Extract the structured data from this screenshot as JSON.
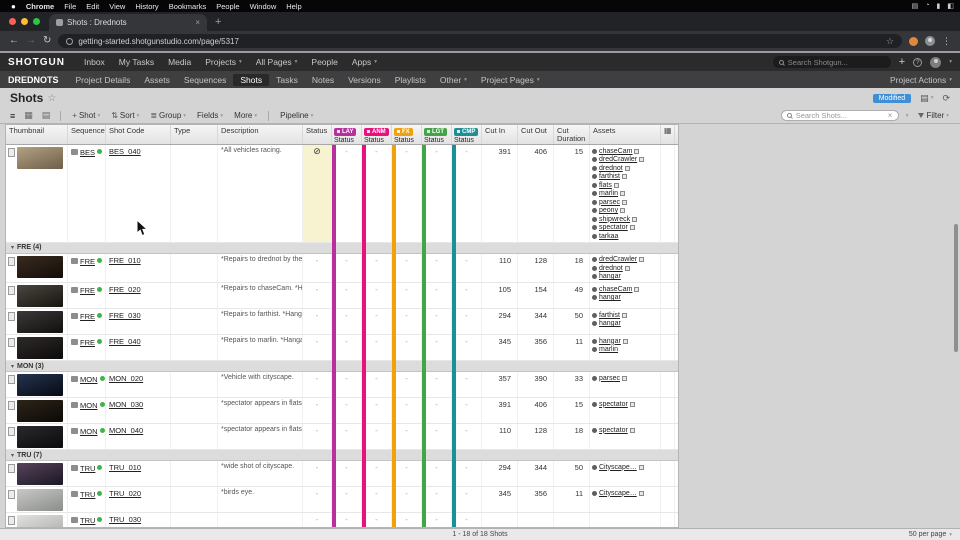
{
  "menubar": {
    "apple_icon": "apple-menu-icon",
    "items": [
      "Chrome",
      "File",
      "Edit",
      "View",
      "History",
      "Bookmarks",
      "People",
      "Window",
      "Help"
    ],
    "status_icons": [
      {
        "name": "display-icon",
        "glyph": "▤"
      },
      {
        "name": "wifi-icon",
        "glyph": "◔"
      },
      {
        "name": "battery-icon",
        "glyph": "▮"
      },
      {
        "name": "control-center-icon",
        "glyph": "◧"
      }
    ]
  },
  "browser": {
    "tab_title": "Shots : Drednots",
    "tab_close": "×",
    "url": "getting-started.shotgunstudio.com/page/5317"
  },
  "app_nav": {
    "logo": "SHOTGUN",
    "items": [
      {
        "label": "Inbox",
        "caret": false
      },
      {
        "label": "My Tasks",
        "caret": false
      },
      {
        "label": "Media",
        "caret": false
      },
      {
        "label": "Projects",
        "caret": true
      },
      {
        "label": "All Pages",
        "caret": true
      },
      {
        "label": "People",
        "caret": false
      },
      {
        "label": "Apps",
        "caret": true
      }
    ],
    "search_placeholder": "Search Shotgun..."
  },
  "project_nav": {
    "project": "DREDNOTS",
    "tabs": [
      {
        "label": "Project Details",
        "caret": false,
        "active": false
      },
      {
        "label": "Assets",
        "caret": false,
        "active": false
      },
      {
        "label": "Sequences",
        "caret": false,
        "active": false
      },
      {
        "label": "Shots",
        "caret": false,
        "active": true
      },
      {
        "label": "Tasks",
        "caret": false,
        "active": false
      },
      {
        "label": "Notes",
        "caret": false,
        "active": false
      },
      {
        "label": "Versions",
        "caret": false,
        "active": false
      },
      {
        "label": "Playlists",
        "caret": false,
        "active": false
      },
      {
        "label": "Other",
        "caret": true,
        "active": false
      },
      {
        "label": "Project Pages",
        "caret": true,
        "active": false
      }
    ],
    "actions": "Project Actions"
  },
  "page": {
    "title": "Shots",
    "star": "☆",
    "modified_badge": "Modified"
  },
  "toolbar": {
    "shot_button": "Shot",
    "sort": "Sort",
    "group": "Group",
    "fields": "Fields",
    "more": "More",
    "pipeline": "Pipeline",
    "search_placeholder": "Search Shots...",
    "filter": "Filter"
  },
  "table": {
    "headers": {
      "thumbnail": "Thumbnail",
      "sequence": "Sequence",
      "shot_code": "Shot Code",
      "type": "Type",
      "description": "Description",
      "status": "Status",
      "cut_in": "Cut In",
      "cut_out": "Cut Out",
      "cut_duration": "Cut Duration",
      "assets": "Assets"
    },
    "pipeline_columns": [
      {
        "label": "LAY",
        "sub": "Status",
        "color": "#b82f9e"
      },
      {
        "label": "ANM",
        "sub": "Status",
        "color": "#e8127d"
      },
      {
        "label": "FX",
        "sub": "Status",
        "color": "#f2a10e"
      },
      {
        "label": "LGT",
        "sub": "Status",
        "color": "#43a547"
      },
      {
        "label": "CMP",
        "sub": "Status",
        "color": "#1d8f96"
      }
    ],
    "groups": [
      {
        "header": null,
        "rows": [
          {
            "seq": "BES",
            "code": "BES_040",
            "desc": "*All vehicles racing.",
            "status": "omit",
            "status_bg": true,
            "pipe": [
              "-",
              "-",
              "-",
              "-",
              "-"
            ],
            "cut_in": "391",
            "cut_out": "406",
            "dur": "15",
            "thumb": [
              "#b3a183",
              "#6d5f49"
            ],
            "assets": [
              {
                "n": "chaseCam",
                "b": 1
              },
              {
                "n": "dredCrawler",
                "b": 1
              },
              {
                "n": "drednot",
                "b": 1
              },
              {
                "n": "farthist",
                "b": 1
              },
              {
                "n": "flats",
                "b": 1
              },
              {
                "n": "marlin",
                "b": 1
              },
              {
                "n": "parsec",
                "b": 1
              },
              {
                "n": "peony",
                "b": 1
              },
              {
                "n": "shipwreck",
                "b": 1
              },
              {
                "n": "spectator",
                "b": 1
              },
              {
                "n": "tarkaa",
                "b": 0
              }
            ]
          }
        ]
      },
      {
        "header": "FRE (4)",
        "rows": [
          {
            "seq": "FRE",
            "code": "FRE_010",
            "desc": "*Repairs to drednot by the d...",
            "status": "-",
            "pipe": [
              "-",
              "-",
              "-",
              "-",
              "-"
            ],
            "cut_in": "110",
            "cut_out": "128",
            "dur": "18",
            "thumb": [
              "#3a2c20",
              "#120d08"
            ],
            "assets": [
              {
                "n": "dredCrawler",
                "b": 1
              },
              {
                "n": "drednot",
                "b": 1
              },
              {
                "n": "hangar",
                "b": 0
              }
            ]
          },
          {
            "seq": "FRE",
            "code": "FRE_020",
            "desc": "*Repairs to chaseCam. *Han...",
            "status": "-",
            "pipe": [
              "-",
              "-",
              "-",
              "-",
              "-"
            ],
            "cut_in": "105",
            "cut_out": "154",
            "dur": "49",
            "thumb": [
              "#4a4640",
              "#17140f"
            ],
            "assets": [
              {
                "n": "chaseCam",
                "b": 1
              },
              {
                "n": "hangar",
                "b": 0
              }
            ]
          },
          {
            "seq": "FRE",
            "code": "FRE_030",
            "desc": "*Repairs to farthist. *Hangar...",
            "status": "-",
            "pipe": [
              "-",
              "-",
              "-",
              "-",
              "-"
            ],
            "cut_in": "294",
            "cut_out": "344",
            "dur": "50",
            "thumb": [
              "#3c3a38",
              "#100f0e"
            ],
            "assets": [
              {
                "n": "farthist",
                "b": 1
              },
              {
                "n": "hangar",
                "b": 0
              }
            ]
          },
          {
            "seq": "FRE",
            "code": "FRE_040",
            "desc": "*Repairs to marlin. *Hangar ...",
            "status": "-",
            "pipe": [
              "-",
              "-",
              "-",
              "-",
              "-"
            ],
            "cut_in": "345",
            "cut_out": "356",
            "dur": "11",
            "thumb": [
              "#2e2a28",
              "#0c0b0a"
            ],
            "assets": [
              {
                "n": "hangar",
                "b": 1
              },
              {
                "n": "marlin",
                "b": 0
              }
            ]
          }
        ]
      },
      {
        "header": "MON (3)",
        "rows": [
          {
            "seq": "MON",
            "code": "MON_020",
            "desc": "*Vehicle with cityscape.",
            "status": "-",
            "pipe": [
              "-",
              "-",
              "-",
              "-",
              "-"
            ],
            "cut_in": "357",
            "cut_out": "390",
            "dur": "33",
            "thumb": [
              "#24344f",
              "#060a14"
            ],
            "assets": [
              {
                "n": "parsec",
                "b": 1
              }
            ]
          },
          {
            "seq": "MON",
            "code": "MON_030",
            "desc": "*spectator appears in flats.",
            "status": "-",
            "pipe": [
              "-",
              "-",
              "-",
              "-",
              "-"
            ],
            "cut_in": "391",
            "cut_out": "406",
            "dur": "15",
            "thumb": [
              "#2c2418",
              "#0b0906"
            ],
            "assets": [
              {
                "n": "spectator",
                "b": 1
              }
            ]
          },
          {
            "seq": "MON",
            "code": "MON_040",
            "desc": "*spectator appears in flats....",
            "status": "-",
            "pipe": [
              "-",
              "-",
              "-",
              "-",
              "-"
            ],
            "cut_in": "110",
            "cut_out": "128",
            "dur": "18",
            "thumb": [
              "#2a2a2e",
              "#0a0a0c"
            ],
            "assets": [
              {
                "n": "spectator",
                "b": 1
              }
            ]
          }
        ]
      },
      {
        "header": "TRU (7)",
        "rows": [
          {
            "seq": "TRU",
            "code": "TRU_010",
            "desc": "*wide shot of cityscape.",
            "status": "-",
            "pipe": [
              "-",
              "-",
              "-",
              "-",
              "-"
            ],
            "cut_in": "294",
            "cut_out": "344",
            "dur": "50",
            "thumb": [
              "#57435c",
              "#1a1722"
            ],
            "assets": [
              {
                "n": "Cityscape",
                "b": 1,
                "t": 1
              }
            ]
          },
          {
            "seq": "TRU",
            "code": "TRU_020",
            "desc": "*birds eye.",
            "status": "-",
            "pipe": [
              "-",
              "-",
              "-",
              "-",
              "-"
            ],
            "cut_in": "345",
            "cut_out": "356",
            "dur": "11",
            "thumb": [
              "#c9c9c7",
              "#8a8d8a"
            ],
            "assets": [
              {
                "n": "Cityscape",
                "b": 1,
                "t": 1
              }
            ]
          },
          {
            "seq": "TRU",
            "code": "TRU_030",
            "desc": "",
            "status": "-",
            "pipe": [
              "-",
              "-",
              "-",
              "-",
              "-"
            ],
            "cut_in": "",
            "cut_out": "",
            "dur": "",
            "thumb": [
              "#e2e2e0",
              "#a9aca9"
            ],
            "assets": []
          }
        ]
      }
    ]
  },
  "footer": {
    "count": "1 - 18 of 18 Shots",
    "per_page": "50 per page"
  },
  "colors": {
    "modified_badge": "#3f8fd6",
    "status_highlight": "#f7f3d0",
    "seq_dot": "#3cb54a"
  }
}
